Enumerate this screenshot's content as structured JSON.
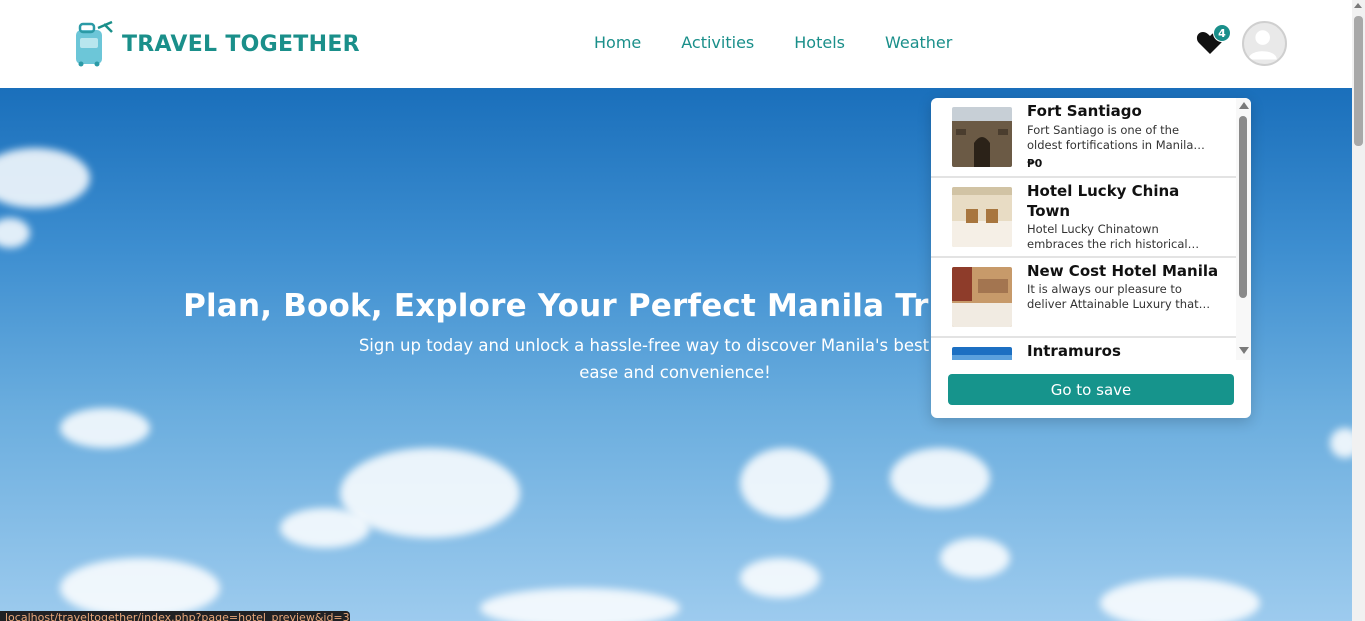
{
  "brand": {
    "name": "TRAVEL TOGETHER"
  },
  "nav": {
    "items": [
      "Home",
      "Activities",
      "Hotels",
      "Weather"
    ]
  },
  "saved": {
    "count": "4"
  },
  "hero": {
    "title": "Plan, Book, Explore Your Perfect Manila Trip",
    "subtitle": "Sign up today and unlock a hassle-free way to discover Manila's best at with ease and convenience!"
  },
  "dropdown": {
    "items": [
      {
        "title": "Fort Santiago",
        "desc": "Fort Santiago is one of the oldest fortifications in Manila…",
        "price": "₱0",
        "thumb_color": "#6b5a45"
      },
      {
        "title": "Hotel Lucky China Town",
        "desc": "Hotel Lucky Chinatown embraces the rich historical…",
        "price": "",
        "thumb_color": "#d9c8a8"
      },
      {
        "title": "New Cost Hotel Manila",
        "desc": "It is always our pleasure to deliver Attainable Luxury that…",
        "price": "",
        "thumb_color": "#b9875a"
      },
      {
        "title": "Intramuros",
        "desc": "",
        "price": "",
        "thumb_color": "#1c6fc2"
      }
    ],
    "save_button": "Go to save"
  },
  "status_url": "localhost/traveltogether/index.php?page=hotel_preview&id=33",
  "colors": {
    "accent": "#1a8f8a",
    "button": "#16948c"
  }
}
